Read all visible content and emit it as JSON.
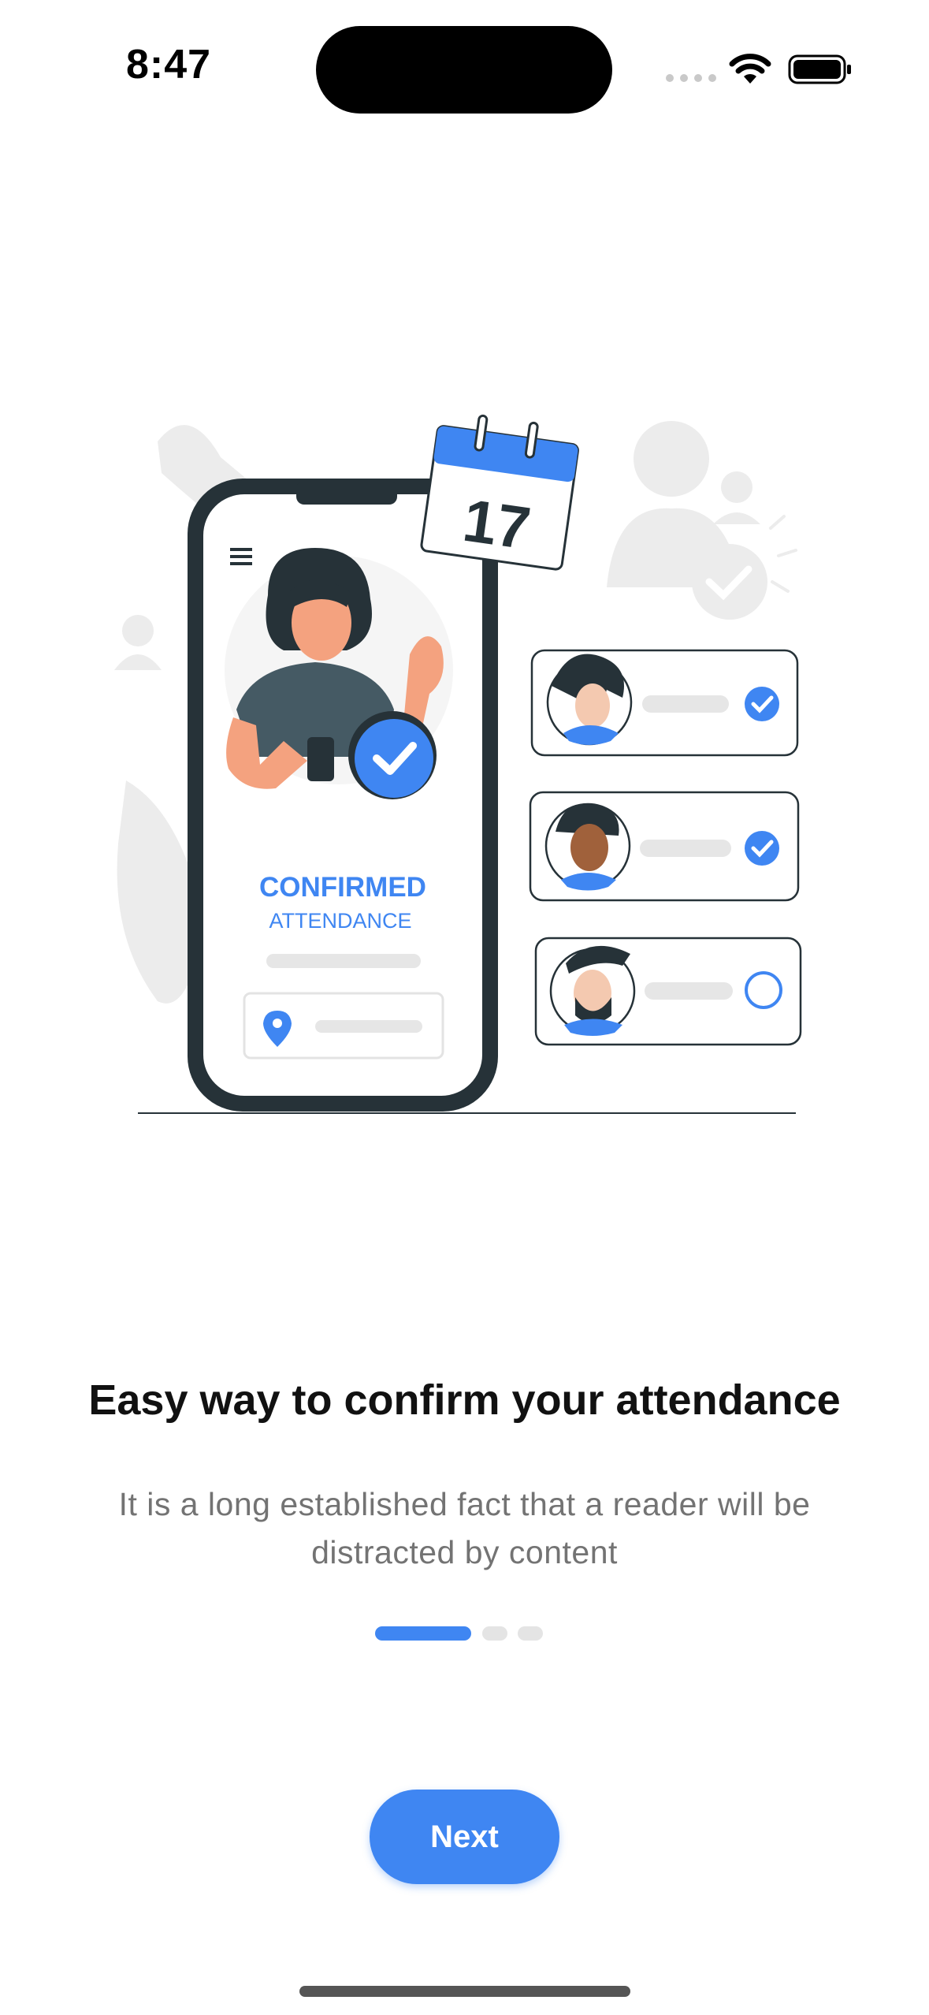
{
  "status_bar": {
    "time": "8:47"
  },
  "illustration": {
    "calendar_day": "17",
    "status_line1": "CONFIRMED",
    "status_line2": "ATTENDANCE"
  },
  "onboarding": {
    "title": "Easy way to confirm your attendance",
    "subtitle": "It is a long established fact that a reader will be distracted by content",
    "page_index": 1,
    "page_count": 3
  },
  "actions": {
    "next_label": "Next"
  },
  "colors": {
    "accent": "#3f86f2",
    "dark": "#263238",
    "light_gray": "#ebebeb"
  }
}
